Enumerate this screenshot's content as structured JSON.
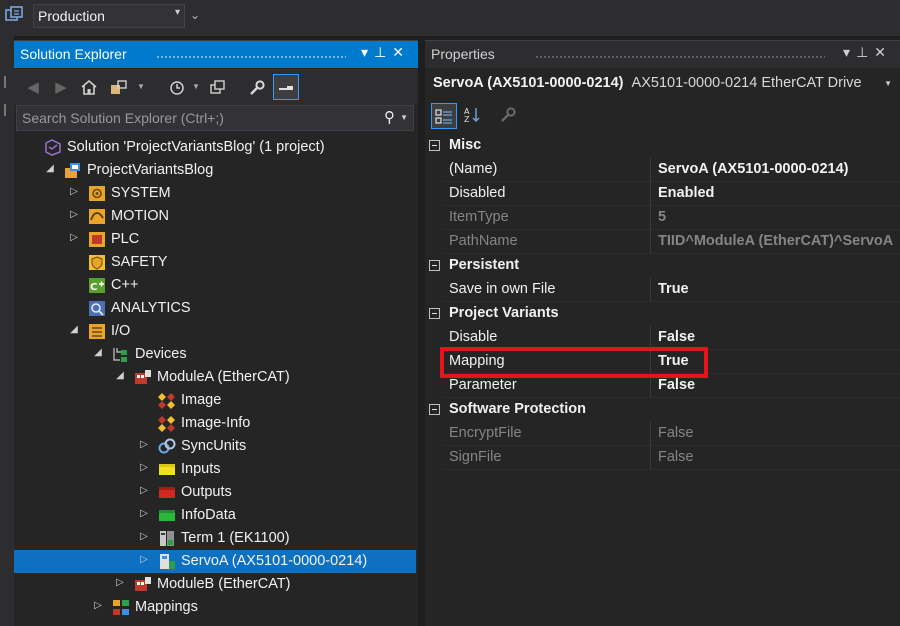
{
  "toolbar": {
    "configuration": "Production"
  },
  "solution_explorer": {
    "title": "Solution Explorer",
    "search_placeholder": "Search Solution Explorer (Ctrl+;)",
    "tree": [
      {
        "label": "Solution 'ProjectVariantsBlog' (1 project)",
        "icon": "solution-icon",
        "expander": ""
      },
      {
        "label": "ProjectVariantsBlog",
        "icon": "project-icon",
        "expander": "open"
      },
      {
        "label": "SYSTEM",
        "icon": "system-icon",
        "expander": "closed"
      },
      {
        "label": "MOTION",
        "icon": "motion-icon",
        "expander": "closed"
      },
      {
        "label": "PLC",
        "icon": "plc-icon",
        "expander": "closed"
      },
      {
        "label": "SAFETY",
        "icon": "safety-icon",
        "expander": ""
      },
      {
        "label": "C++",
        "icon": "cpp-icon",
        "expander": ""
      },
      {
        "label": "ANALYTICS",
        "icon": "analytics-icon",
        "expander": ""
      },
      {
        "label": "I/O",
        "icon": "io-icon",
        "expander": "open"
      },
      {
        "label": "Devices",
        "icon": "devices-icon",
        "expander": "open"
      },
      {
        "label": "ModuleA (EtherCAT)",
        "icon": "ethercat-master-icon",
        "expander": "open"
      },
      {
        "label": "Image",
        "icon": "image-icon",
        "expander": ""
      },
      {
        "label": "Image-Info",
        "icon": "image-info-icon",
        "expander": ""
      },
      {
        "label": "SyncUnits",
        "icon": "syncunits-icon",
        "expander": "closed"
      },
      {
        "label": "Inputs",
        "icon": "inputs-icon",
        "expander": "closed"
      },
      {
        "label": "Outputs",
        "icon": "outputs-icon",
        "expander": "closed"
      },
      {
        "label": "InfoData",
        "icon": "infodata-icon",
        "expander": "closed"
      },
      {
        "label": "Term 1 (EK1100)",
        "icon": "terminal-icon",
        "expander": "closed"
      },
      {
        "label": "ServoA (AX5101-0000-0214)",
        "icon": "servo-drive-icon",
        "expander": "closed",
        "selected": true
      },
      {
        "label": "ModuleB (EtherCAT)",
        "icon": "ethercat-master-icon",
        "expander": "closed"
      },
      {
        "label": "Mappings",
        "icon": "mappings-icon",
        "expander": "closed"
      }
    ]
  },
  "properties": {
    "title": "Properties",
    "object_name": "ServoA (AX5101-0000-0214)",
    "object_type": "AX5101-0000-0214 EtherCAT Drive",
    "categories": [
      {
        "name": "Misc",
        "props": [
          {
            "name": "(Name)",
            "value": "ServoA (AX5101-0000-0214)",
            "readonly": false
          },
          {
            "name": "Disabled",
            "value": "Enabled",
            "readonly": false
          },
          {
            "name": "ItemType",
            "value": "5",
            "readonly": true,
            "bold": true
          },
          {
            "name": "PathName",
            "value": "TIID^ModuleA (EtherCAT)^ServoA",
            "readonly": true,
            "bold": true
          }
        ]
      },
      {
        "name": "Persistent",
        "props": [
          {
            "name": "Save in own File",
            "value": "True",
            "readonly": false
          }
        ]
      },
      {
        "name": "Project Variants",
        "props": [
          {
            "name": "Disable",
            "value": "False",
            "readonly": false
          },
          {
            "name": "Mapping",
            "value": "True",
            "readonly": false
          },
          {
            "name": "Parameter",
            "value": "False",
            "readonly": false
          }
        ]
      },
      {
        "name": "Software Protection",
        "props": [
          {
            "name": "EncryptFile",
            "value": "False",
            "readonly": true
          },
          {
            "name": "SignFile",
            "value": "False",
            "readonly": true
          }
        ]
      }
    ]
  }
}
